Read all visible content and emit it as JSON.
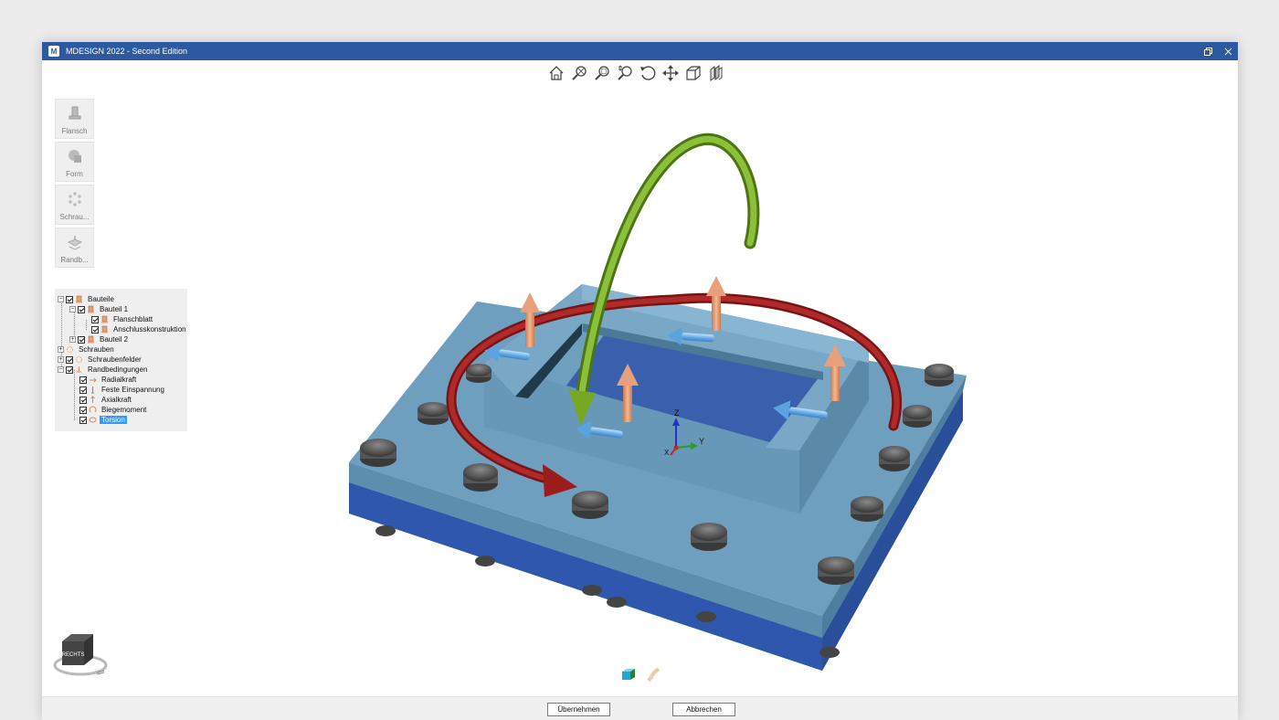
{
  "window": {
    "title": "MDESIGN 2022 - Second Edition",
    "icon_letter": "M"
  },
  "toolbar": {
    "tools": [
      "home-view-icon",
      "zoom-extents-icon",
      "zoom-window-icon",
      "zoom-icon",
      "rotate-icon",
      "pan-icon",
      "view-cube-icon",
      "section-view-icon"
    ]
  },
  "sidebar": {
    "items": [
      {
        "label": "Flansch",
        "icon": "flange-icon"
      },
      {
        "label": "Form",
        "icon": "shape-icon"
      },
      {
        "label": "Schrau...",
        "icon": "bolts-icon"
      },
      {
        "label": "Randb...",
        "icon": "boundary-icon"
      }
    ]
  },
  "tree": {
    "bauteile": "Bauteile",
    "bauteil1": "Bauteil 1",
    "flanschblatt": "Flanschblatt",
    "anschluss": "Anschlusskonstruktion",
    "bauteil2": "Bauteil 2",
    "schrauben": "Schrauben",
    "schraubenfelder": "Schraubenfelder",
    "randbedingungen": "Randbedingungen",
    "radialkraft": "Radialkraft",
    "einspannung": "Feste Einspannung",
    "axialkraft": "Axialkraft",
    "biegemoment": "Biegemoment",
    "torsion": "Torsion"
  },
  "viewport": {
    "axes": {
      "z": "Z",
      "y": "Y",
      "x": "X"
    },
    "navcube_label": "RECHTS",
    "colors": {
      "plate_top": "#6e9fbe",
      "plate_bottom": "#3560b8",
      "torsion": "#9c1c1c",
      "bending": "#76a824",
      "axial_force": "#e4a07a",
      "radial_force": "#6aaee6",
      "bolt": "#5b5b5b"
    }
  },
  "footer": {
    "ok_label": "Übernehmen",
    "cancel_label": "Abbrechen"
  }
}
